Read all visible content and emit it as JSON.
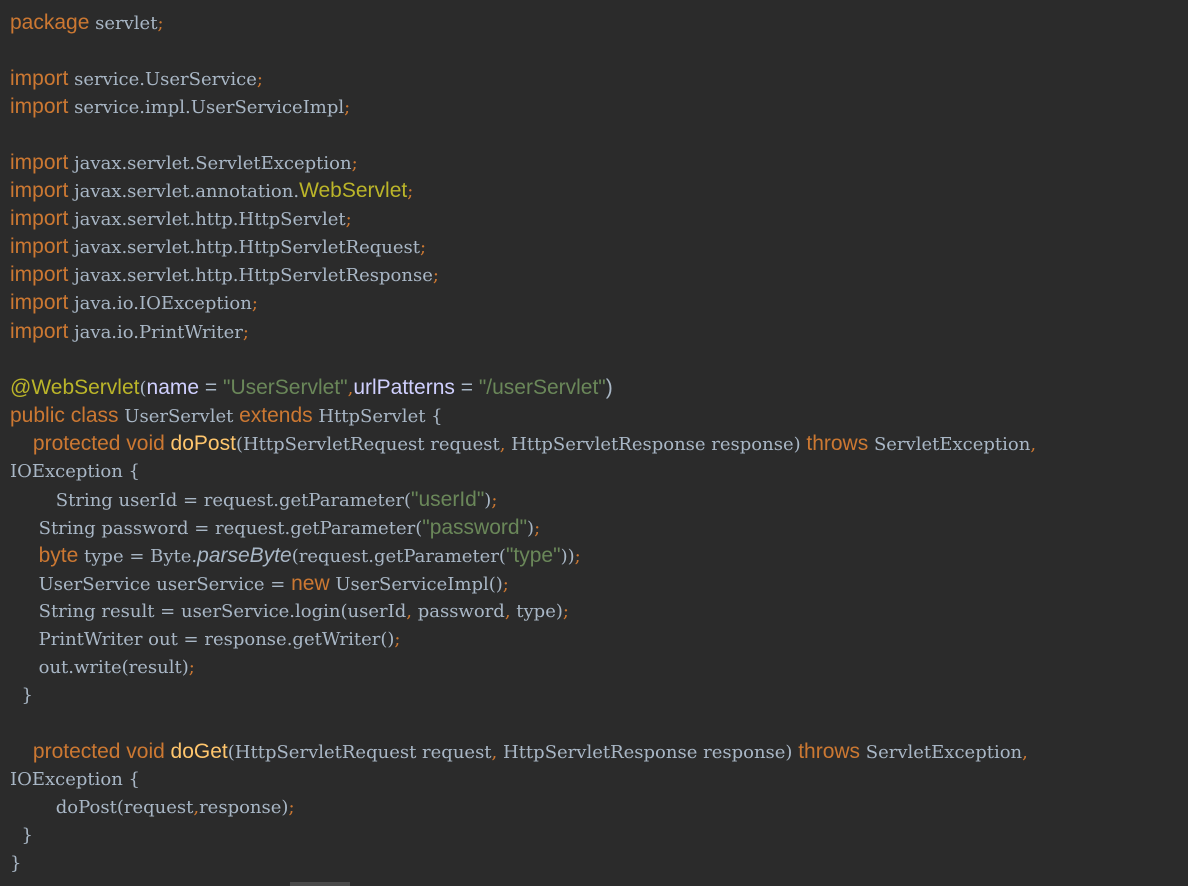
{
  "theme": {
    "background": "#2b2b2b",
    "keyword": "#cc7832",
    "identifier": "#a9b7c6",
    "annotation": "#bbb529",
    "string": "#6a8759",
    "annotation_param": "#d0d0ff",
    "method_declaration": "#ffc66d"
  },
  "lines": [
    [
      [
        "kw",
        "package"
      ],
      [
        "id",
        " servlet"
      ],
      [
        "punct",
        ";"
      ]
    ],
    [],
    [
      [
        "kw",
        "import"
      ],
      [
        "id",
        " service.UserService"
      ],
      [
        "punct",
        ";"
      ]
    ],
    [
      [
        "kw",
        "import"
      ],
      [
        "id",
        " service.impl.UserServiceImpl"
      ],
      [
        "punct",
        ";"
      ]
    ],
    [],
    [
      [
        "kw",
        "import"
      ],
      [
        "id",
        " javax.servlet.ServletException"
      ],
      [
        "punct",
        ";"
      ]
    ],
    [
      [
        "kw",
        "import"
      ],
      [
        "id",
        " javax.servlet.annotation."
      ],
      [
        "anno",
        "WebServlet"
      ],
      [
        "punct",
        ";"
      ]
    ],
    [
      [
        "kw",
        "import"
      ],
      [
        "id",
        " javax.servlet.http.HttpServlet"
      ],
      [
        "punct",
        ";"
      ]
    ],
    [
      [
        "kw",
        "import"
      ],
      [
        "id",
        " javax.servlet.http.HttpServletRequest"
      ],
      [
        "punct",
        ";"
      ]
    ],
    [
      [
        "kw",
        "import"
      ],
      [
        "id",
        " javax.servlet.http.HttpServletResponse"
      ],
      [
        "punct",
        ";"
      ]
    ],
    [
      [
        "kw",
        "import"
      ],
      [
        "id",
        " java.io.IOException"
      ],
      [
        "punct",
        ";"
      ]
    ],
    [
      [
        "kw",
        "import"
      ],
      [
        "id",
        " java.io.PrintWriter"
      ],
      [
        "punct",
        ";"
      ]
    ],
    [],
    [
      [
        "anno",
        "@WebServlet"
      ],
      [
        "paren",
        "("
      ],
      [
        "param",
        "name"
      ],
      [
        "plain",
        " = "
      ],
      [
        "str",
        "\"UserServlet\""
      ],
      [
        "punct",
        ","
      ],
      [
        "param",
        "urlPatterns"
      ],
      [
        "plain",
        " = "
      ],
      [
        "str",
        "\"/userServlet\""
      ],
      [
        "plain",
        ")"
      ]
    ],
    [
      [
        "kw",
        "public class"
      ],
      [
        "id",
        " UserServlet "
      ],
      [
        "kw",
        "extends"
      ],
      [
        "id",
        " HttpServlet {"
      ]
    ],
    [
      [
        "id",
        "    "
      ],
      [
        "kw",
        "protected void"
      ],
      [
        "id",
        " "
      ],
      [
        "method",
        "doPost"
      ],
      [
        "id",
        "(HttpServletRequest request"
      ],
      [
        "punct",
        ","
      ],
      [
        "id",
        " HttpServletResponse response) "
      ],
      [
        "kw",
        "throws"
      ],
      [
        "id",
        " ServletException"
      ],
      [
        "punct",
        ","
      ]
    ],
    [
      [
        "id",
        "IOException {"
      ]
    ],
    [
      [
        "id",
        "        String userId = request.getParameter("
      ],
      [
        "str",
        "\"userId\""
      ],
      [
        "id",
        ")"
      ],
      [
        "punct",
        ";"
      ]
    ],
    [
      [
        "id",
        "     String password = request.getParameter("
      ],
      [
        "str",
        "\"password\""
      ],
      [
        "id",
        ")"
      ],
      [
        "punct",
        ";"
      ]
    ],
    [
      [
        "id",
        "     "
      ],
      [
        "kw",
        "byte"
      ],
      [
        "id",
        " type = Byte."
      ],
      [
        "static",
        "parseByte"
      ],
      [
        "id",
        "(request.getParameter("
      ],
      [
        "str",
        "\"type\""
      ],
      [
        "id",
        "))"
      ],
      [
        "punct",
        ";"
      ]
    ],
    [
      [
        "id",
        "     UserService userService = "
      ],
      [
        "kw",
        "new"
      ],
      [
        "id",
        " UserServiceImpl()"
      ],
      [
        "punct",
        ";"
      ]
    ],
    [
      [
        "id",
        "     String result = userService.login(userId"
      ],
      [
        "punct",
        ","
      ],
      [
        "id",
        " password"
      ],
      [
        "punct",
        ","
      ],
      [
        "id",
        " type)"
      ],
      [
        "punct",
        ";"
      ]
    ],
    [
      [
        "id",
        "     PrintWriter out = response.getWriter()"
      ],
      [
        "punct",
        ";"
      ]
    ],
    [
      [
        "id",
        "     out.write(result)"
      ],
      [
        "punct",
        ";"
      ]
    ],
    [
      [
        "id",
        "  }"
      ]
    ],
    [],
    [
      [
        "id",
        "    "
      ],
      [
        "kw",
        "protected void"
      ],
      [
        "id",
        " "
      ],
      [
        "method",
        "doGet"
      ],
      [
        "id",
        "(HttpServletRequest request"
      ],
      [
        "punct",
        ","
      ],
      [
        "id",
        " HttpServletResponse response) "
      ],
      [
        "kw",
        "throws"
      ],
      [
        "id",
        " ServletException"
      ],
      [
        "punct",
        ","
      ]
    ],
    [
      [
        "id",
        "IOException {"
      ]
    ],
    [
      [
        "id",
        "        doPost(request"
      ],
      [
        "punct",
        ","
      ],
      [
        "id",
        "response)"
      ],
      [
        "punct",
        ";"
      ]
    ],
    [
      [
        "id",
        "  }"
      ]
    ],
    [
      [
        "id",
        "}"
      ]
    ]
  ]
}
